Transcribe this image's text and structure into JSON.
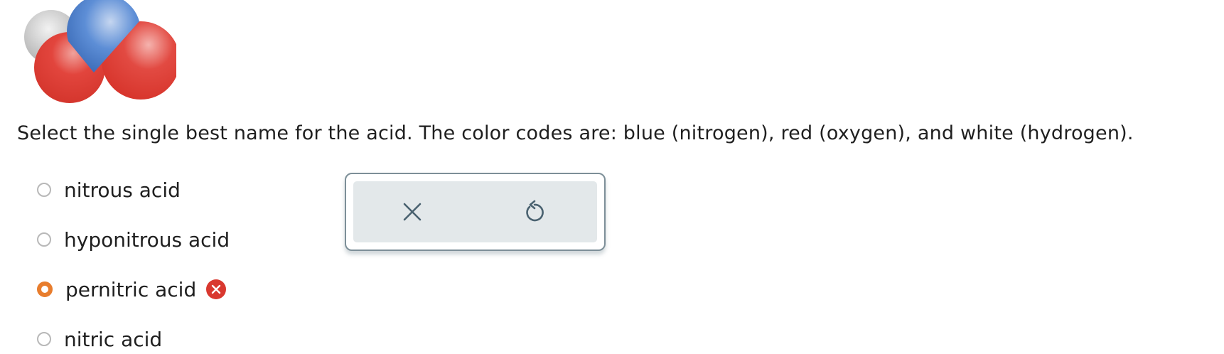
{
  "molecule": {
    "image_label": "ball-and-stick space-filling model of the acid",
    "atoms": [
      {
        "element": "hydrogen",
        "color": "#c9c9c9"
      },
      {
        "element": "oxygen",
        "color": "#e2403a"
      },
      {
        "element": "oxygen",
        "color": "#e2403a"
      },
      {
        "element": "nitrogen",
        "color": "#4d7fcb"
      }
    ]
  },
  "question": {
    "text": "Select the single best name for the acid. The color codes are: blue (nitrogen), red (oxygen), and white (hydrogen)."
  },
  "options": [
    {
      "label": "nitrous acid",
      "selected": false
    },
    {
      "label": "hyponitrous acid",
      "selected": false
    },
    {
      "label": "pernitric acid",
      "selected": true,
      "marked_incorrect": true
    },
    {
      "label": "nitric acid",
      "selected": false
    }
  ],
  "toolbar": {
    "clear_icon": "x-icon",
    "undo_icon": "undo-icon"
  },
  "colors": {
    "selected_radio": "#e87d2d",
    "incorrect_badge": "#d9382f",
    "tool_background": "#e3e8ea",
    "tool_border": "#7d8f98",
    "tool_icon": "#4a6270"
  }
}
